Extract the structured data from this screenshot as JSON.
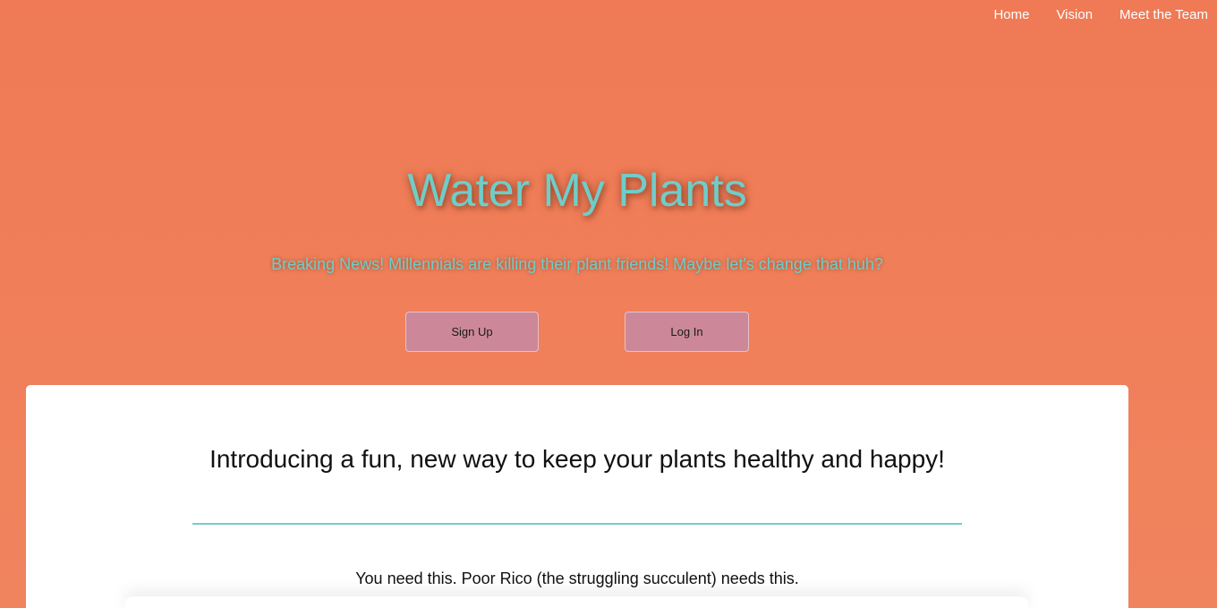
{
  "nav": {
    "items": [
      {
        "label": "Home"
      },
      {
        "label": "Vision"
      },
      {
        "label": "Meet the Team"
      }
    ]
  },
  "hero": {
    "title": "Water My Plants",
    "subtitle": "Breaking News! Millennials are killing their plant friends! Maybe let's change that huh?",
    "signup_label": "Sign Up",
    "login_label": "Log In"
  },
  "intro": {
    "heading": "Introducing a fun, new way to keep your plants healthy and happy!",
    "text": "You need this. Poor Rico (the struggling succulent) needs this."
  },
  "colors": {
    "background": "#ef7a55",
    "accent_teal": "#6fcdc8",
    "button": "#cc8899",
    "divider": "#7ac8d4",
    "card": "#ffffff"
  }
}
